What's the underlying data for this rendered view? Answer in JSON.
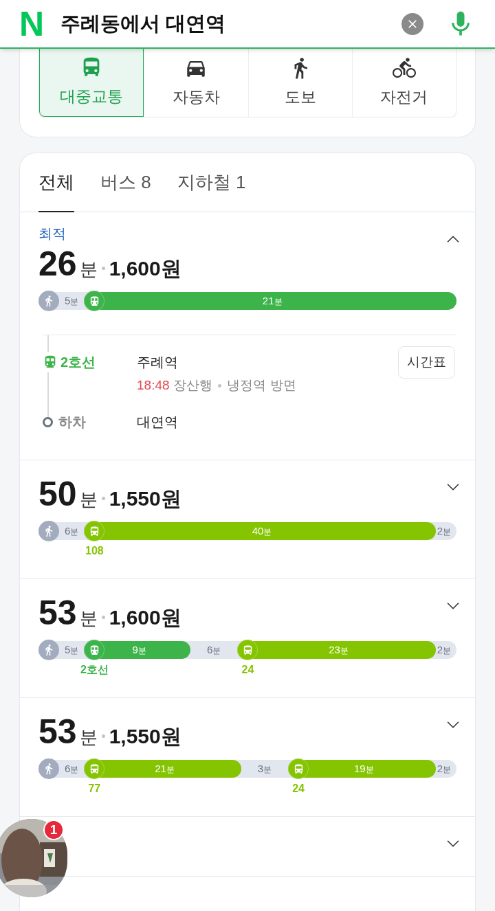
{
  "header": {
    "logo": "N",
    "query": "주례동에서 대연역"
  },
  "modes": [
    {
      "kind": "transit",
      "label": "대중교통",
      "selected": true
    },
    {
      "kind": "car",
      "label": "자동차",
      "selected": false
    },
    {
      "kind": "walk",
      "label": "도보",
      "selected": false
    },
    {
      "kind": "bike",
      "label": "자전거",
      "selected": false
    }
  ],
  "filters": [
    {
      "label": "전체",
      "selected": true
    },
    {
      "label": "버스 8",
      "selected": false
    },
    {
      "label": "지하철 1",
      "selected": false
    }
  ],
  "routes": [
    {
      "badge": "최적",
      "expanded": true,
      "minutes": "26",
      "unit": "분",
      "fare": "1,600원",
      "segments": [
        {
          "kind": "walk",
          "time": "5분"
        },
        {
          "kind": "subway",
          "time": "21분"
        }
      ],
      "details": {
        "line": "2호선",
        "board_station": "주례역",
        "timetable_button": "시간표",
        "departure": "18:48",
        "destination": "장산행",
        "direction": "냉정역 방면",
        "alight_label": "하차",
        "alight_station": "대연역"
      }
    },
    {
      "expanded": false,
      "minutes": "50",
      "unit": "분",
      "fare": "1,550원",
      "segments": [
        {
          "kind": "walk",
          "time": "6분"
        },
        {
          "kind": "bus",
          "time": "40분",
          "line": "108"
        },
        {
          "kind": "walk",
          "time": "2분"
        }
      ]
    },
    {
      "expanded": false,
      "minutes": "53",
      "unit": "분",
      "fare": "1,600원",
      "segments": [
        {
          "kind": "walk",
          "time": "5분"
        },
        {
          "kind": "subway",
          "time": "9분",
          "line": "2호선"
        },
        {
          "kind": "walk",
          "time": "6분"
        },
        {
          "kind": "bus",
          "time": "23분",
          "line": "24"
        },
        {
          "kind": "walk",
          "time": "2분"
        }
      ]
    },
    {
      "expanded": false,
      "minutes": "53",
      "unit": "분",
      "fare": "1,550원",
      "segments": [
        {
          "kind": "walk",
          "time": "6분"
        },
        {
          "kind": "bus",
          "time": "21분",
          "line": "77"
        },
        {
          "kind": "walk",
          "time": "3분"
        },
        {
          "kind": "bus",
          "time": "19분",
          "line": "24"
        },
        {
          "kind": "walk",
          "time": "2분"
        }
      ]
    },
    {
      "expanded": false
    }
  ],
  "floating_avatar": {
    "kind": "picture",
    "badge": "1"
  }
}
